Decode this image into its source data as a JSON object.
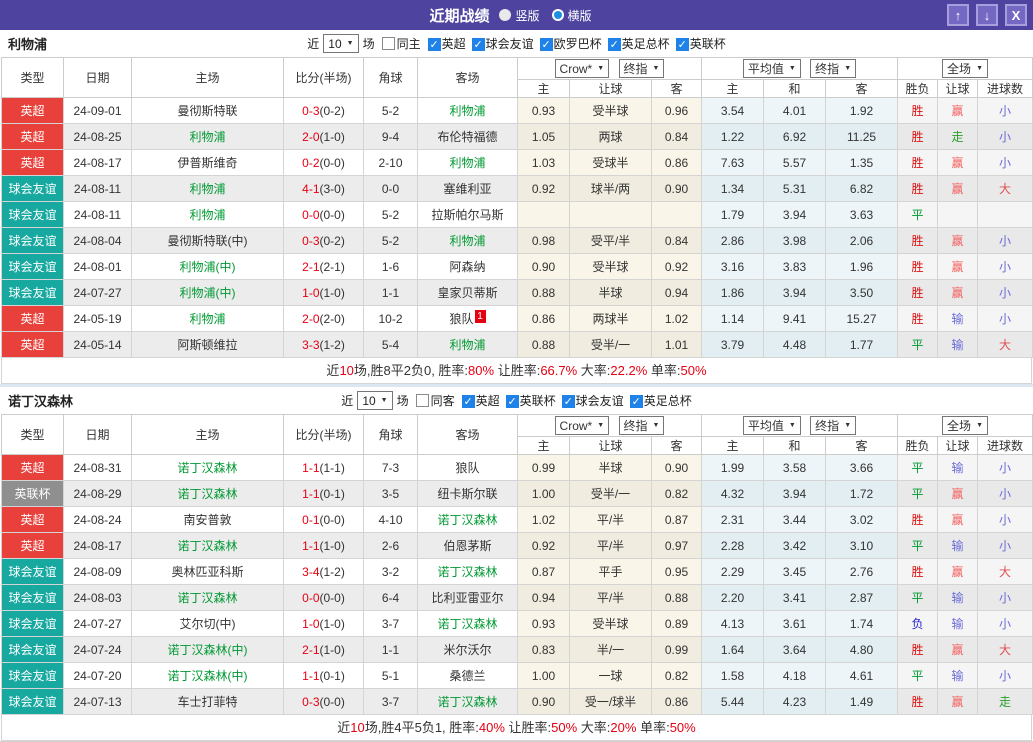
{
  "colors": {
    "titlebar_purple": "#4e44a0",
    "league_red": "#e8403a",
    "league_teal": "#17a8a0",
    "league_gray": "#8f8f8f",
    "focus_team_green": "#009933",
    "score_red": "#e60012",
    "win_red": "#dd1111",
    "draw_green": "#009933",
    "lose_blue": "#2222cc",
    "cover_red": "#f55f5f",
    "fail_violet": "#6a6ad8",
    "push_green": "#2aa02a",
    "checkbox_blue": "#1e82e8"
  },
  "window": {
    "title": "近期战绩",
    "radios": [
      {
        "label": "竖版",
        "selected": false
      },
      {
        "label": "横版",
        "selected": true
      }
    ],
    "buttons": {
      "up": "↑",
      "down": "↓",
      "close": "X"
    }
  },
  "table_header": {
    "static_cols": [
      "类型",
      "日期",
      "主场",
      "比分(半场)",
      "角球",
      "客场"
    ],
    "group1": {
      "dropdowns": [
        "Crow*",
        "终指"
      ],
      "cols": [
        "主",
        "让球",
        "客"
      ]
    },
    "group2": {
      "dropdowns": [
        "平均值",
        "终指"
      ],
      "cols": [
        "主",
        "和",
        "客"
      ]
    },
    "group3": {
      "dropdowns": [
        "全场"
      ],
      "cols": [
        "胜负",
        "让球",
        "进球数"
      ]
    }
  },
  "sections": [
    {
      "team": "利物浦",
      "filter": {
        "prefix": "近",
        "count": "10",
        "suffix": "场",
        "same": {
          "label": "同主",
          "checked": false
        },
        "leagues": [
          {
            "label": "英超",
            "checked": true
          },
          {
            "label": "球会友谊",
            "checked": true
          },
          {
            "label": "欧罗巴杯",
            "checked": true
          },
          {
            "label": "英足总杯",
            "checked": true
          },
          {
            "label": "英联杯",
            "checked": true
          }
        ]
      },
      "rows": [
        {
          "league": "英超",
          "date": "24-09-01",
          "home": "曼彻斯特联",
          "home_focus": false,
          "score": "0-3",
          "half": "(0-2)",
          "corners": "5-2",
          "away": "利物浦",
          "away_focus": true,
          "asian": [
            "0.93",
            "受半球",
            "0.96"
          ],
          "euro": [
            "3.54",
            "4.01",
            "1.92"
          ],
          "result": [
            "胜",
            "赢",
            "小"
          ]
        },
        {
          "league": "英超",
          "date": "24-08-25",
          "home": "利物浦",
          "home_focus": true,
          "score": "2-0",
          "half": "(1-0)",
          "corners": "9-4",
          "away": "布伦特福德",
          "away_focus": false,
          "asian": [
            "1.05",
            "两球",
            "0.84"
          ],
          "euro": [
            "1.22",
            "6.92",
            "11.25"
          ],
          "result": [
            "胜",
            "走",
            "小"
          ]
        },
        {
          "league": "英超",
          "date": "24-08-17",
          "home": "伊普斯维奇",
          "home_focus": false,
          "score": "0-2",
          "half": "(0-0)",
          "corners": "2-10",
          "away": "利物浦",
          "away_focus": true,
          "asian": [
            "1.03",
            "受球半",
            "0.86"
          ],
          "euro": [
            "7.63",
            "5.57",
            "1.35"
          ],
          "result": [
            "胜",
            "赢",
            "小"
          ]
        },
        {
          "league": "球会友谊",
          "date": "24-08-11",
          "home": "利物浦",
          "home_focus": true,
          "score": "4-1",
          "half": "(3-0)",
          "corners": "0-0",
          "away": "塞维利亚",
          "away_focus": false,
          "asian": [
            "0.92",
            "球半/两",
            "0.90"
          ],
          "euro": [
            "1.34",
            "5.31",
            "6.82"
          ],
          "result": [
            "胜",
            "赢",
            "大"
          ]
        },
        {
          "league": "球会友谊",
          "date": "24-08-11",
          "home": "利物浦",
          "home_focus": true,
          "score": "0-0",
          "half": "(0-0)",
          "corners": "5-2",
          "away": "拉斯帕尔马斯",
          "away_focus": false,
          "asian": [
            "",
            "",
            ""
          ],
          "euro": [
            "1.79",
            "3.94",
            "3.63"
          ],
          "result": [
            "平",
            "",
            ""
          ]
        },
        {
          "league": "球会友谊",
          "date": "24-08-04",
          "home": "曼彻斯特联(中)",
          "home_focus": false,
          "score": "0-3",
          "half": "(0-2)",
          "corners": "5-2",
          "away": "利物浦",
          "away_focus": true,
          "asian": [
            "0.98",
            "受平/半",
            "0.84"
          ],
          "euro": [
            "2.86",
            "3.98",
            "2.06"
          ],
          "result": [
            "胜",
            "赢",
            "小"
          ]
        },
        {
          "league": "球会友谊",
          "date": "24-08-01",
          "home": "利物浦(中)",
          "home_focus": true,
          "score": "2-1",
          "half": "(2-1)",
          "corners": "1-6",
          "away": "阿森纳",
          "away_focus": false,
          "asian": [
            "0.90",
            "受半球",
            "0.92"
          ],
          "euro": [
            "3.16",
            "3.83",
            "1.96"
          ],
          "result": [
            "胜",
            "赢",
            "小"
          ]
        },
        {
          "league": "球会友谊",
          "date": "24-07-27",
          "home": "利物浦(中)",
          "home_focus": true,
          "score": "1-0",
          "half": "(1-0)",
          "corners": "1-1",
          "away": "皇家贝蒂斯",
          "away_focus": false,
          "asian": [
            "0.88",
            "半球",
            "0.94"
          ],
          "euro": [
            "1.86",
            "3.94",
            "3.50"
          ],
          "result": [
            "胜",
            "赢",
            "小"
          ]
        },
        {
          "league": "英超",
          "date": "24-05-19",
          "home": "利物浦",
          "home_focus": true,
          "score": "2-0",
          "half": "(2-0)",
          "corners": "10-2",
          "away": "狼队",
          "away_focus": false,
          "away_badge": "1",
          "asian": [
            "0.86",
            "两球半",
            "1.02"
          ],
          "euro": [
            "1.14",
            "9.41",
            "15.27"
          ],
          "result": [
            "胜",
            "输",
            "小"
          ]
        },
        {
          "league": "英超",
          "date": "24-05-14",
          "home": "阿斯顿维拉",
          "home_focus": false,
          "score": "3-3",
          "half": "(1-2)",
          "corners": "5-4",
          "away": "利物浦",
          "away_focus": true,
          "asian": [
            "0.88",
            "受半/一",
            "1.01"
          ],
          "euro": [
            "3.79",
            "4.48",
            "1.77"
          ],
          "result": [
            "平",
            "输",
            "大"
          ]
        }
      ],
      "summary": [
        [
          "近",
          "normal"
        ],
        [
          "10",
          "red"
        ],
        [
          "场,胜8平2负0, 胜率:",
          "normal"
        ],
        [
          "80%",
          "red"
        ],
        [
          " 让胜率:",
          "normal"
        ],
        [
          "66.7%",
          "red"
        ],
        [
          " 大率:",
          "normal"
        ],
        [
          "22.2%",
          "red"
        ],
        [
          " 单率:",
          "normal"
        ],
        [
          "50%",
          "red"
        ]
      ]
    },
    {
      "team": "诺丁汉森林",
      "filter": {
        "prefix": "近",
        "count": "10",
        "suffix": "场",
        "same": {
          "label": "同客",
          "checked": false
        },
        "leagues": [
          {
            "label": "英超",
            "checked": true
          },
          {
            "label": "英联杯",
            "checked": true
          },
          {
            "label": "球会友谊",
            "checked": true
          },
          {
            "label": "英足总杯",
            "checked": true
          }
        ]
      },
      "rows": [
        {
          "league": "英超",
          "date": "24-08-31",
          "home": "诺丁汉森林",
          "home_focus": true,
          "score": "1-1",
          "half": "(1-1)",
          "corners": "7-3",
          "away": "狼队",
          "away_focus": false,
          "asian": [
            "0.99",
            "半球",
            "0.90"
          ],
          "euro": [
            "1.99",
            "3.58",
            "3.66"
          ],
          "result": [
            "平",
            "输",
            "小"
          ]
        },
        {
          "league": "英联杯",
          "date": "24-08-29",
          "home": "诺丁汉森林",
          "home_focus": true,
          "score": "1-1",
          "half": "(0-1)",
          "corners": "3-5",
          "away": "纽卡斯尔联",
          "away_focus": false,
          "asian": [
            "1.00",
            "受半/一",
            "0.82"
          ],
          "euro": [
            "4.32",
            "3.94",
            "1.72"
          ],
          "result": [
            "平",
            "赢",
            "小"
          ]
        },
        {
          "league": "英超",
          "date": "24-08-24",
          "home": "南安普敦",
          "home_focus": false,
          "score": "0-1",
          "half": "(0-0)",
          "corners": "4-10",
          "away": "诺丁汉森林",
          "away_focus": true,
          "asian": [
            "1.02",
            "平/半",
            "0.87"
          ],
          "euro": [
            "2.31",
            "3.44",
            "3.02"
          ],
          "result": [
            "胜",
            "赢",
            "小"
          ]
        },
        {
          "league": "英超",
          "date": "24-08-17",
          "home": "诺丁汉森林",
          "home_focus": true,
          "score": "1-1",
          "half": "(1-0)",
          "corners": "2-6",
          "away": "伯恩茅斯",
          "away_focus": false,
          "asian": [
            "0.92",
            "平/半",
            "0.97"
          ],
          "euro": [
            "2.28",
            "3.42",
            "3.10"
          ],
          "result": [
            "平",
            "输",
            "小"
          ]
        },
        {
          "league": "球会友谊",
          "date": "24-08-09",
          "home": "奥林匹亚科斯",
          "home_focus": false,
          "score": "3-4",
          "half": "(1-2)",
          "corners": "3-2",
          "away": "诺丁汉森林",
          "away_focus": true,
          "asian": [
            "0.87",
            "平手",
            "0.95"
          ],
          "euro": [
            "2.29",
            "3.45",
            "2.76"
          ],
          "result": [
            "胜",
            "赢",
            "大"
          ]
        },
        {
          "league": "球会友谊",
          "date": "24-08-03",
          "home": "诺丁汉森林",
          "home_focus": true,
          "score": "0-0",
          "half": "(0-0)",
          "corners": "6-4",
          "away": "比利亚雷亚尔",
          "away_focus": false,
          "asian": [
            "0.94",
            "平/半",
            "0.88"
          ],
          "euro": [
            "2.20",
            "3.41",
            "2.87"
          ],
          "result": [
            "平",
            "输",
            "小"
          ]
        },
        {
          "league": "球会友谊",
          "date": "24-07-27",
          "home": "艾尔切(中)",
          "home_focus": false,
          "score": "1-0",
          "half": "(1-0)",
          "corners": "3-7",
          "away": "诺丁汉森林",
          "away_focus": true,
          "asian": [
            "0.93",
            "受半球",
            "0.89"
          ],
          "euro": [
            "4.13",
            "3.61",
            "1.74"
          ],
          "result": [
            "负",
            "输",
            "小"
          ]
        },
        {
          "league": "球会友谊",
          "date": "24-07-24",
          "home": "诺丁汉森林(中)",
          "home_focus": true,
          "score": "2-1",
          "half": "(1-0)",
          "corners": "1-1",
          "away": "米尔沃尔",
          "away_focus": false,
          "asian": [
            "0.83",
            "半/一",
            "0.99"
          ],
          "euro": [
            "1.64",
            "3.64",
            "4.80"
          ],
          "result": [
            "胜",
            "赢",
            "大"
          ]
        },
        {
          "league": "球会友谊",
          "date": "24-07-20",
          "home": "诺丁汉森林(中)",
          "home_focus": true,
          "score": "1-1",
          "half": "(0-1)",
          "corners": "5-1",
          "away": "桑德兰",
          "away_focus": false,
          "asian": [
            "1.00",
            "一球",
            "0.82"
          ],
          "euro": [
            "1.58",
            "4.18",
            "4.61"
          ],
          "result": [
            "平",
            "输",
            "小"
          ]
        },
        {
          "league": "球会友谊",
          "date": "24-07-13",
          "home": "车士打菲特",
          "home_focus": false,
          "score": "0-3",
          "half": "(0-0)",
          "corners": "3-7",
          "away": "诺丁汉森林",
          "away_focus": true,
          "asian": [
            "0.90",
            "受一/球半",
            "0.86"
          ],
          "euro": [
            "5.44",
            "4.23",
            "1.49"
          ],
          "result": [
            "胜",
            "赢",
            "走"
          ]
        }
      ],
      "summary": [
        [
          "近",
          "normal"
        ],
        [
          "10",
          "red"
        ],
        [
          "场,胜4平5负1, 胜率:",
          "normal"
        ],
        [
          "40%",
          "red"
        ],
        [
          " 让胜率:",
          "normal"
        ],
        [
          "50%",
          "red"
        ],
        [
          " 大率:",
          "normal"
        ],
        [
          "20%",
          "red"
        ],
        [
          " 单率:",
          "normal"
        ],
        [
          "50%",
          "red"
        ]
      ]
    }
  ]
}
